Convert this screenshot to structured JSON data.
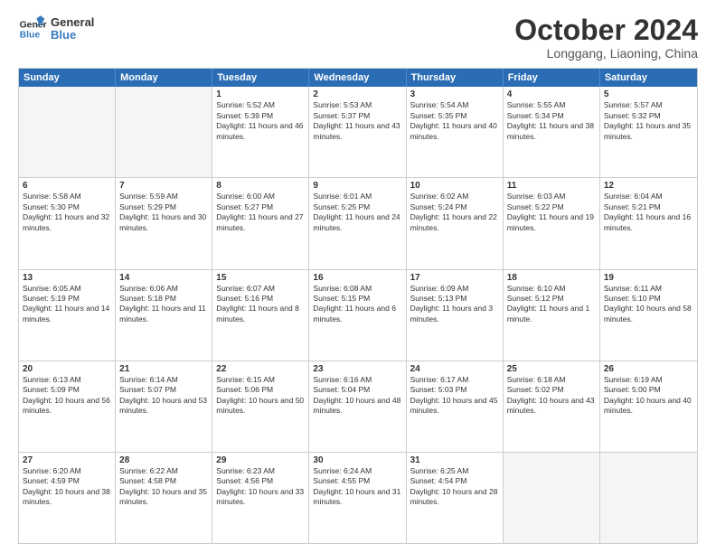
{
  "logo": {
    "line1": "General",
    "line2": "Blue"
  },
  "title": "October 2024",
  "location": "Longgang, Liaoning, China",
  "header_days": [
    "Sunday",
    "Monday",
    "Tuesday",
    "Wednesday",
    "Thursday",
    "Friday",
    "Saturday"
  ],
  "rows": [
    [
      {
        "day": "",
        "text": "",
        "empty": true
      },
      {
        "day": "",
        "text": "",
        "empty": true
      },
      {
        "day": "1",
        "text": "Sunrise: 5:52 AM\nSunset: 5:39 PM\nDaylight: 11 hours and 46 minutes."
      },
      {
        "day": "2",
        "text": "Sunrise: 5:53 AM\nSunset: 5:37 PM\nDaylight: 11 hours and 43 minutes."
      },
      {
        "day": "3",
        "text": "Sunrise: 5:54 AM\nSunset: 5:35 PM\nDaylight: 11 hours and 40 minutes."
      },
      {
        "day": "4",
        "text": "Sunrise: 5:55 AM\nSunset: 5:34 PM\nDaylight: 11 hours and 38 minutes."
      },
      {
        "day": "5",
        "text": "Sunrise: 5:57 AM\nSunset: 5:32 PM\nDaylight: 11 hours and 35 minutes."
      }
    ],
    [
      {
        "day": "6",
        "text": "Sunrise: 5:58 AM\nSunset: 5:30 PM\nDaylight: 11 hours and 32 minutes."
      },
      {
        "day": "7",
        "text": "Sunrise: 5:59 AM\nSunset: 5:29 PM\nDaylight: 11 hours and 30 minutes."
      },
      {
        "day": "8",
        "text": "Sunrise: 6:00 AM\nSunset: 5:27 PM\nDaylight: 11 hours and 27 minutes."
      },
      {
        "day": "9",
        "text": "Sunrise: 6:01 AM\nSunset: 5:25 PM\nDaylight: 11 hours and 24 minutes."
      },
      {
        "day": "10",
        "text": "Sunrise: 6:02 AM\nSunset: 5:24 PM\nDaylight: 11 hours and 22 minutes."
      },
      {
        "day": "11",
        "text": "Sunrise: 6:03 AM\nSunset: 5:22 PM\nDaylight: 11 hours and 19 minutes."
      },
      {
        "day": "12",
        "text": "Sunrise: 6:04 AM\nSunset: 5:21 PM\nDaylight: 11 hours and 16 minutes."
      }
    ],
    [
      {
        "day": "13",
        "text": "Sunrise: 6:05 AM\nSunset: 5:19 PM\nDaylight: 11 hours and 14 minutes."
      },
      {
        "day": "14",
        "text": "Sunrise: 6:06 AM\nSunset: 5:18 PM\nDaylight: 11 hours and 11 minutes."
      },
      {
        "day": "15",
        "text": "Sunrise: 6:07 AM\nSunset: 5:16 PM\nDaylight: 11 hours and 8 minutes."
      },
      {
        "day": "16",
        "text": "Sunrise: 6:08 AM\nSunset: 5:15 PM\nDaylight: 11 hours and 6 minutes."
      },
      {
        "day": "17",
        "text": "Sunrise: 6:09 AM\nSunset: 5:13 PM\nDaylight: 11 hours and 3 minutes."
      },
      {
        "day": "18",
        "text": "Sunrise: 6:10 AM\nSunset: 5:12 PM\nDaylight: 11 hours and 1 minute."
      },
      {
        "day": "19",
        "text": "Sunrise: 6:11 AM\nSunset: 5:10 PM\nDaylight: 10 hours and 58 minutes."
      }
    ],
    [
      {
        "day": "20",
        "text": "Sunrise: 6:13 AM\nSunset: 5:09 PM\nDaylight: 10 hours and 56 minutes."
      },
      {
        "day": "21",
        "text": "Sunrise: 6:14 AM\nSunset: 5:07 PM\nDaylight: 10 hours and 53 minutes."
      },
      {
        "day": "22",
        "text": "Sunrise: 6:15 AM\nSunset: 5:06 PM\nDaylight: 10 hours and 50 minutes."
      },
      {
        "day": "23",
        "text": "Sunrise: 6:16 AM\nSunset: 5:04 PM\nDaylight: 10 hours and 48 minutes."
      },
      {
        "day": "24",
        "text": "Sunrise: 6:17 AM\nSunset: 5:03 PM\nDaylight: 10 hours and 45 minutes."
      },
      {
        "day": "25",
        "text": "Sunrise: 6:18 AM\nSunset: 5:02 PM\nDaylight: 10 hours and 43 minutes."
      },
      {
        "day": "26",
        "text": "Sunrise: 6:19 AM\nSunset: 5:00 PM\nDaylight: 10 hours and 40 minutes."
      }
    ],
    [
      {
        "day": "27",
        "text": "Sunrise: 6:20 AM\nSunset: 4:59 PM\nDaylight: 10 hours and 38 minutes."
      },
      {
        "day": "28",
        "text": "Sunrise: 6:22 AM\nSunset: 4:58 PM\nDaylight: 10 hours and 35 minutes."
      },
      {
        "day": "29",
        "text": "Sunrise: 6:23 AM\nSunset: 4:56 PM\nDaylight: 10 hours and 33 minutes."
      },
      {
        "day": "30",
        "text": "Sunrise: 6:24 AM\nSunset: 4:55 PM\nDaylight: 10 hours and 31 minutes."
      },
      {
        "day": "31",
        "text": "Sunrise: 6:25 AM\nSunset: 4:54 PM\nDaylight: 10 hours and 28 minutes."
      },
      {
        "day": "",
        "text": "",
        "empty": true
      },
      {
        "day": "",
        "text": "",
        "empty": true
      }
    ]
  ]
}
